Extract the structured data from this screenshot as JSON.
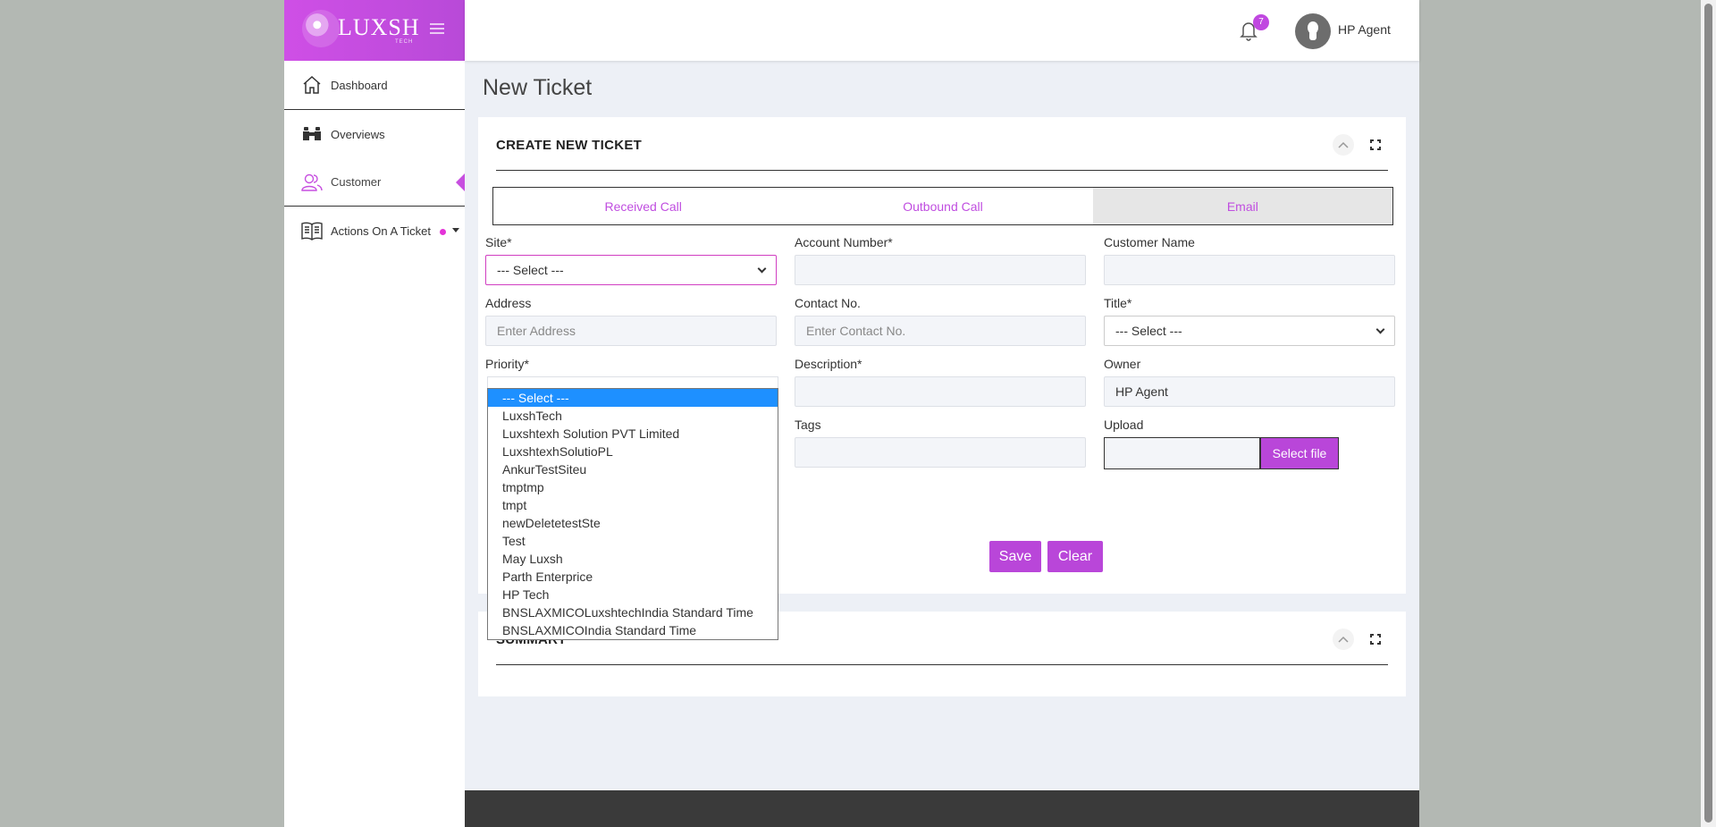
{
  "brand": {
    "logo_text": "LUXSH",
    "logo_sub": "TECH"
  },
  "sidebar": {
    "items": [
      {
        "label": "Dashboard",
        "icon": "home-icon"
      },
      {
        "label": "Overviews",
        "icon": "binoculars-icon"
      },
      {
        "label": "Customer",
        "icon": "users-icon"
      },
      {
        "label": "Actions On A Ticket",
        "icon": "book-icon"
      }
    ]
  },
  "topbar": {
    "notification_count": "7",
    "user_name": "HP Agent"
  },
  "page": {
    "title": "New Ticket"
  },
  "ticket_card": {
    "title": "CREATE NEW TICKET",
    "tabs": [
      {
        "label": "Received Call",
        "active": false
      },
      {
        "label": "Outbound Call",
        "active": false
      },
      {
        "label": "Email",
        "active": true
      }
    ],
    "fields": {
      "site": {
        "label": "Site*",
        "value": "--- Select ---"
      },
      "account_number": {
        "label": "Account Number*",
        "value": ""
      },
      "customer_name": {
        "label": "Customer Name",
        "value": ""
      },
      "address": {
        "label": "Address",
        "placeholder": "Enter Address"
      },
      "contact_no": {
        "label": "Contact No.",
        "placeholder": "Enter Contact No."
      },
      "title": {
        "label": "Title*",
        "value": "--- Select ---"
      },
      "priority": {
        "label": "Priority*",
        "value": "--- Select ---"
      },
      "description": {
        "label": "Description*",
        "value": ""
      },
      "owner": {
        "label": "Owner",
        "value": "HP Agent"
      },
      "tags": {
        "label": "Tags",
        "value": ""
      },
      "upload": {
        "label": "Upload",
        "button": "Select file"
      }
    },
    "buttons": {
      "save": "Save",
      "clear": "Clear"
    }
  },
  "dropdown": {
    "selected_index": 0,
    "options": [
      "--- Select ---",
      "LuxshTech",
      "Luxshtexh Solution PVT Limited",
      "LuxshtexhSolutioPL",
      "AnkurTestSiteu",
      "tmptmp",
      "tmpt",
      "newDeletetestSte",
      "Test",
      "May Luxsh",
      "Parth Enterprice",
      "HP Tech",
      "BNSLAXMICOLuxshtechIndia Standard Time",
      "BNSLAXMICOIndia Standard Time"
    ]
  },
  "summary_card": {
    "title": "SUMMARY"
  },
  "colors": {
    "brand": "#c74fe0",
    "accent": "#b946d9",
    "selected_option": "#1e90ff"
  }
}
